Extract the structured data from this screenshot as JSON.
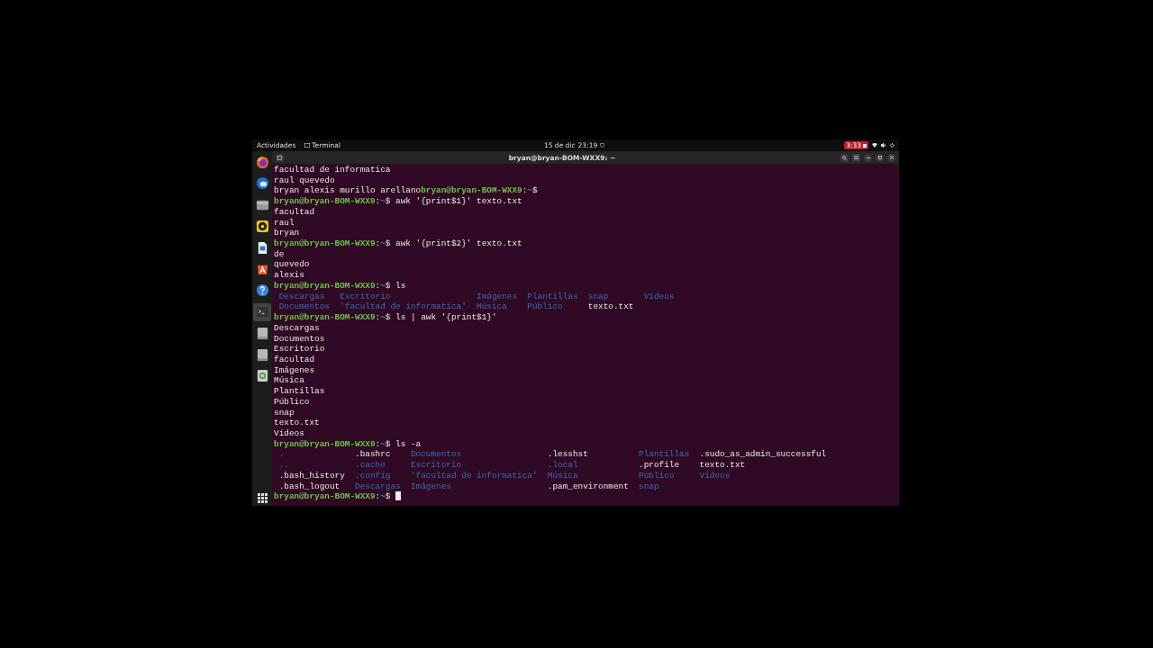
{
  "top_bar": {
    "activities": "Actividades",
    "app": "Terminal",
    "date": "15 de dic",
    "time": "23:19",
    "recording_badge": "3:33"
  },
  "dock": {
    "items": [
      {
        "kind": "firefox",
        "selected": false
      },
      {
        "kind": "mail",
        "selected": false
      },
      {
        "kind": "files",
        "selected": false
      },
      {
        "kind": "music",
        "selected": false
      },
      {
        "kind": "writer",
        "selected": false
      },
      {
        "kind": "store",
        "selected": false
      },
      {
        "kind": "help",
        "selected": false
      },
      {
        "kind": "terminal",
        "selected": true
      },
      {
        "kind": "drive",
        "selected": false
      },
      {
        "kind": "drive",
        "selected": false
      },
      {
        "kind": "trash",
        "selected": false
      }
    ]
  },
  "terminal": {
    "title": "bryan@bryan-BOM-WXX9: ~",
    "lines": [
      {
        "kind": "output",
        "text": "facultad de informatica"
      },
      {
        "kind": "output",
        "text": "raul quevedo"
      },
      {
        "kind": "prompt",
        "before": "bryan alexis murillo arellano",
        "user_host": "bryan@bryan-BOM-WXX9",
        "sep": ":",
        "path": "~",
        "sign": "$"
      },
      {
        "kind": "prompt",
        "user_host": "bryan@bryan-BOM-WXX9",
        "sep": ":",
        "path": "~",
        "sign": "$",
        "command": "awk '{print$1}' texto.txt"
      },
      {
        "kind": "output",
        "text": "facultad"
      },
      {
        "kind": "output",
        "text": "raul"
      },
      {
        "kind": "output",
        "text": "bryan"
      },
      {
        "kind": "prompt",
        "user_host": "bryan@bryan-BOM-WXX9",
        "sep": ":",
        "path": "~",
        "sign": "$",
        "command": "awk '{print$2}' texto.txt"
      },
      {
        "kind": "output",
        "text": "de"
      },
      {
        "kind": "output",
        "text": "quevedo"
      },
      {
        "kind": "output",
        "text": "alexis"
      },
      {
        "kind": "prompt",
        "user_host": "bryan@bryan-BOM-WXX9",
        "sep": ":",
        "path": "~",
        "sign": "$",
        "command": "ls"
      },
      {
        "kind": "listing",
        "rows": [
          [
            {
              "text": "Descargas",
              "directory": true
            },
            {
              "text": "Escritorio",
              "directory": true
            },
            {
              "text": "Imágenes",
              "directory": true
            },
            {
              "text": "Plantillas",
              "directory": true
            },
            {
              "text": "snap",
              "directory": true
            },
            {
              "text": "Videos",
              "directory": true
            }
          ],
          [
            {
              "text": "Documentos",
              "directory": true
            },
            {
              "text": "'facultad de informatica'",
              "directory": true
            },
            {
              "text": "Música",
              "directory": true
            },
            {
              "text": "Público",
              "directory": true
            },
            {
              "text": "texto.txt",
              "directory": false
            }
          ]
        ]
      },
      {
        "kind": "prompt",
        "user_host": "bryan@bryan-BOM-WXX9",
        "sep": ":",
        "path": "~",
        "sign": "$",
        "command": "ls | awk '{print$1}'"
      },
      {
        "kind": "output",
        "text": "Descargas"
      },
      {
        "kind": "output",
        "text": "Documentos"
      },
      {
        "kind": "output",
        "text": "Escritorio"
      },
      {
        "kind": "output",
        "text": "facultad"
      },
      {
        "kind": "output",
        "text": "Imágenes"
      },
      {
        "kind": "output",
        "text": "Música"
      },
      {
        "kind": "output",
        "text": "Plantillas"
      },
      {
        "kind": "output",
        "text": "Público"
      },
      {
        "kind": "output",
        "text": "snap"
      },
      {
        "kind": "output",
        "text": "texto.txt"
      },
      {
        "kind": "output",
        "text": "Videos"
      },
      {
        "kind": "prompt",
        "user_host": "bryan@bryan-BOM-WXX9",
        "sep": ":",
        "path": "~",
        "sign": "$",
        "command": "ls -a"
      },
      {
        "kind": "listing",
        "rows": [
          [
            {
              "text": ".",
              "directory": true
            },
            {
              "text": ".bashrc",
              "directory": false
            },
            {
              "text": "Documentos",
              "directory": true
            },
            {
              "text": ".lesshst",
              "directory": false
            },
            {
              "text": "Plantillas",
              "directory": true
            },
            {
              "text": ".sudo_as_admin_successful",
              "directory": false
            }
          ],
          [
            {
              "text": "..",
              "directory": true
            },
            {
              "text": ".cache",
              "directory": true
            },
            {
              "text": "Escritorio",
              "directory": true
            },
            {
              "text": ".local",
              "directory": true
            },
            {
              "text": ".profile",
              "directory": false
            },
            {
              "text": "texto.txt",
              "directory": false
            }
          ],
          [
            {
              "text": ".bash_history",
              "directory": false
            },
            {
              "text": ".config",
              "directory": true
            },
            {
              "text": "'facultad de informatica'",
              "directory": true
            },
            {
              "text": "Música",
              "directory": true
            },
            {
              "text": "Público",
              "directory": true
            },
            {
              "text": "Videos",
              "directory": true
            }
          ],
          [
            {
              "text": ".bash_logout",
              "directory": false
            },
            {
              "text": "Descargas",
              "directory": true
            },
            {
              "text": "Imágenes",
              "directory": true
            },
            {
              "text": ".pam_environment",
              "directory": false
            },
            {
              "text": "snap",
              "directory": true
            }
          ]
        ]
      },
      {
        "kind": "prompt",
        "user_host": "bryan@bryan-BOM-WXX9",
        "sep": ":",
        "path": "~",
        "sign": "$",
        "cursor": true
      }
    ]
  }
}
